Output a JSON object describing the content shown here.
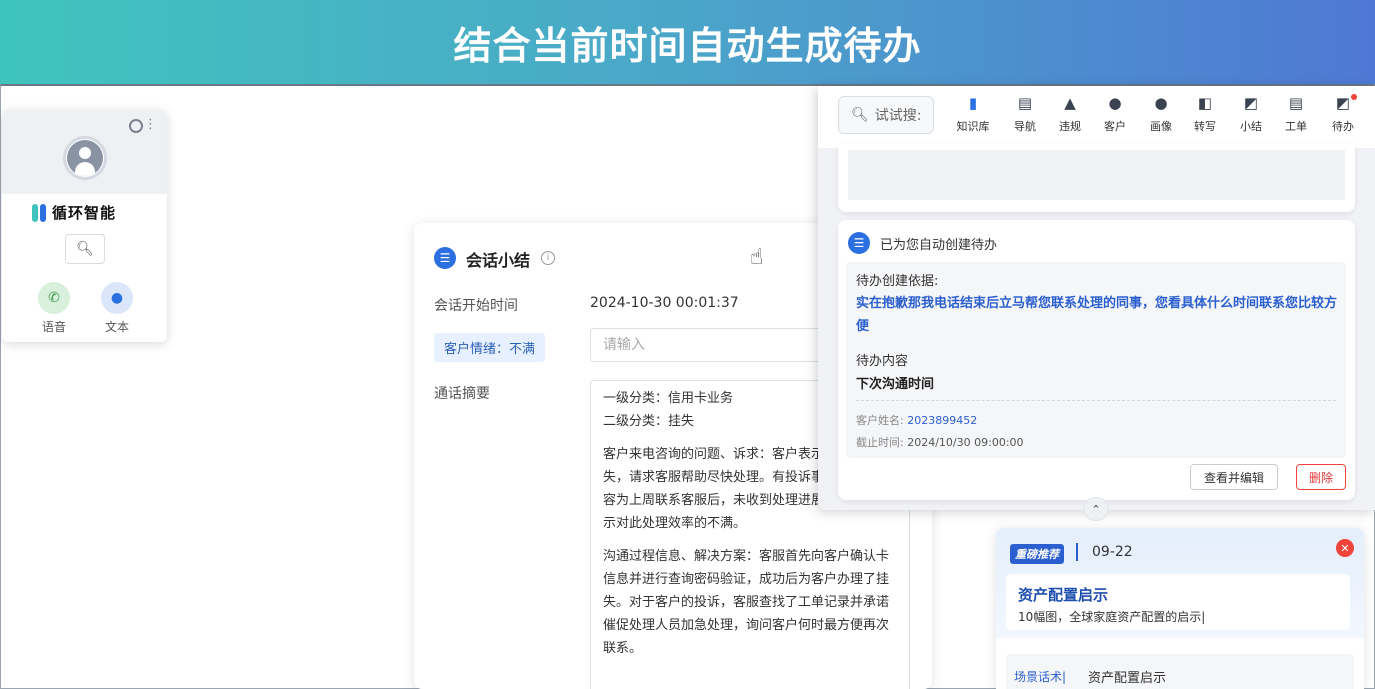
{
  "banner": {
    "title": "结合当前时间自动生成待办"
  },
  "widget": {
    "brand": "循环智能",
    "modes": [
      {
        "label": "语音",
        "icon": "phone-icon"
      },
      {
        "label": "文本",
        "icon": "chat-icon"
      }
    ]
  },
  "summary": {
    "title": "会话小结",
    "start_label": "会话开始时间",
    "start_value": "2024-10-30 00:01:37",
    "emotion_tag": "客户情绪：不满",
    "input_placeholder": "请输入",
    "abstract_label": "通话摘要",
    "abstract_lines": [
      "一级分类：信用卡业务",
      "二级分类：挂失",
      "客户来电咨询的问题、诉求：客户表示信用卡丢失，请求客服帮助尽快处理。有投诉事项，投诉内容为上周联系客服后，未收到处理进展的回复，表示对此处理效率的不满。",
      "沟通过程信息、解决方案：客服首先向客户确认卡信息并进行查询密码验证，成功后为客户办理了挂失。对于客户的投诉，客服查找了工单记录并承诺催促处理人员加急处理，询问客户何时最方便再次联系。"
    ]
  },
  "toolbar": {
    "search_label": "试试搜:",
    "tools": [
      {
        "label": "知识库",
        "icon": "book-icon"
      },
      {
        "label": "导航",
        "icon": "doc-icon"
      },
      {
        "label": "违规",
        "icon": "warning-icon"
      },
      {
        "label": "客户",
        "icon": "user-icon"
      },
      {
        "label": "画像",
        "icon": "portrait-icon"
      },
      {
        "label": "转写",
        "icon": "transcribe-icon"
      },
      {
        "label": "小结",
        "icon": "summary-icon"
      },
      {
        "label": "工单",
        "icon": "ticket-icon"
      },
      {
        "label": "待办",
        "icon": "todo-icon"
      }
    ]
  },
  "todo": {
    "header": "已为您自动创建待办",
    "basis_label": "待办创建依据:",
    "basis_text": "实在抱歉那我电话结束后立马帮您联系处理的同事，您看具体什么时间联系您比较方便",
    "content_label": "待办内容",
    "content_value": "下次沟通时间",
    "customer_label": "客户姓名:",
    "customer_value": "2023899452",
    "deadline_label": "截止时间:",
    "deadline_value": "2024/10/30 09:00:00",
    "edit_button": "查看并编辑",
    "delete_button": "删除"
  },
  "recommend": {
    "badge": "重磅推荐",
    "date": "09-22",
    "title": "资产配置启示",
    "desc": "10幅图，全球家庭资产配置的启示|",
    "tag": "场景话术|",
    "tag_text": "资产配置启示"
  },
  "colors": {
    "accent": "#2b6fe0",
    "danger": "#f0433a",
    "banner_start": "#3fc4bd",
    "banner_end": "#4f78d4"
  }
}
